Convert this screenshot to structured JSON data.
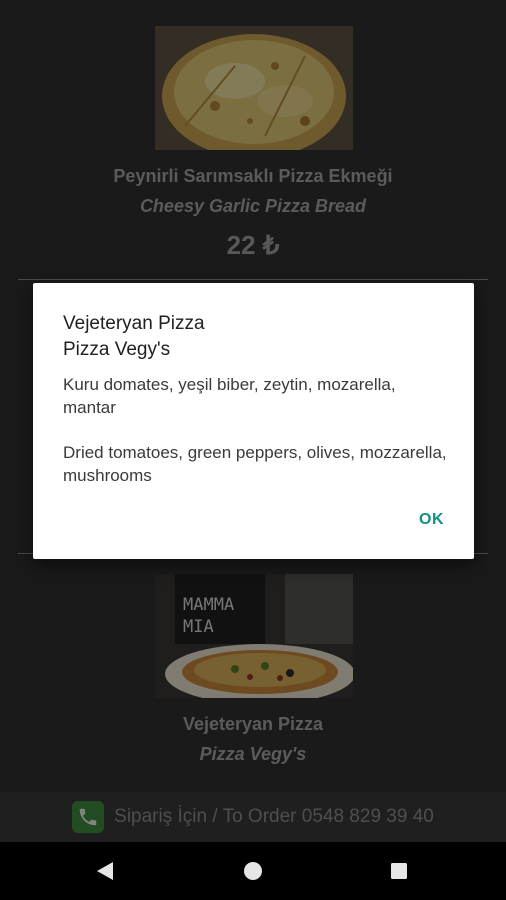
{
  "menu": {
    "items": [
      {
        "name_tr": "Peynirli Sarımsaklı Pizza Ekmeği",
        "name_en": "Cheesy Garlic Pizza Bread",
        "price": "22 ₺"
      },
      {
        "name_tr": "Vejeteryan Pizza",
        "name_en": "Pizza Vegy's",
        "photo_text": "MAMMA\nMIA"
      }
    ]
  },
  "order_bar": {
    "text": "Sipariş İçin / To Order 0548 829 39 40",
    "icon": "phone-icon",
    "icon_color": "#3f8a3c"
  },
  "dialog": {
    "title_line1": "Vejeteryan Pizza",
    "title_line2": "Pizza Vegy's",
    "message_tr": "Kuru domates, yeşil biber, zeytin, mozarella, mantar",
    "message_en": "Dried tomatoes, green peppers, olives, mozzarella, mushrooms",
    "ok_label": "OK",
    "accent_color": "#138f82"
  },
  "navigation": {
    "back_icon": "back-triangle-icon",
    "home_icon": "home-circle-icon",
    "recents_icon": "recents-square-icon"
  }
}
